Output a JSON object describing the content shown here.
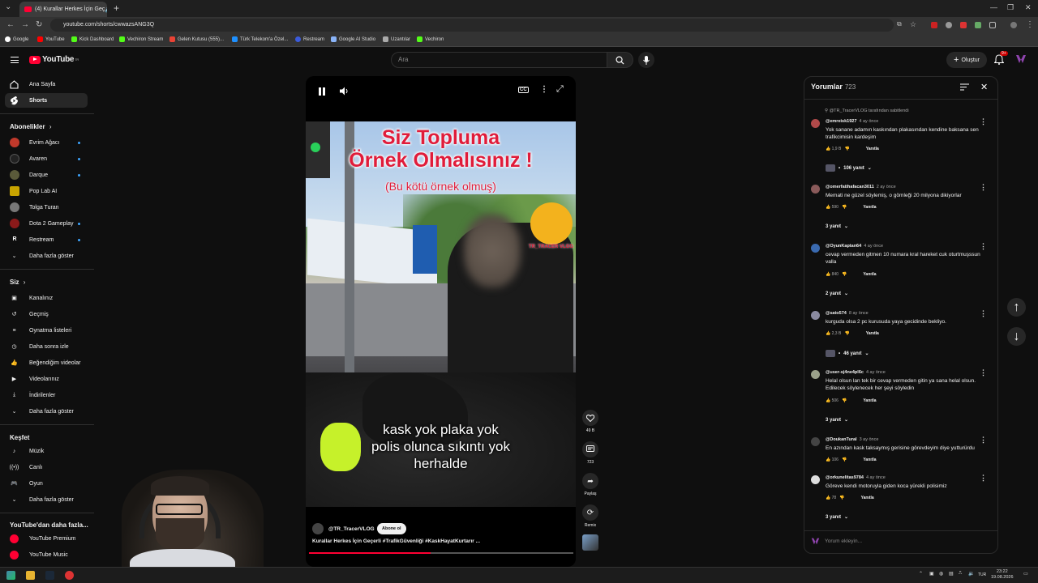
{
  "browser": {
    "tab_title": "(4) Kurallar Herkes İçin Geç",
    "url": "youtube.com/shorts/cwwazsANG3Q",
    "bookmarks": [
      "Google",
      "YouTube",
      "Kick Dashboard",
      "Vechiron Stream",
      "Gelen Kutusu (555)...",
      "Türk Telekom'a Özel...",
      "Restream",
      "Google AI Studio",
      "Uzantılar",
      "Vechiron"
    ]
  },
  "header": {
    "logo_text": "YouTube",
    "logo_sup": "TR",
    "search_placeholder": "Ara",
    "create_label": "Oluştur",
    "notification_count": "9+"
  },
  "sidebar": {
    "main": [
      {
        "label": "Ana Sayfa",
        "icon": "home-icon"
      },
      {
        "label": "Shorts",
        "icon": "shorts-icon",
        "active": true
      }
    ],
    "subscriptions_title": "Abonelikler",
    "subscriptions": [
      {
        "label": "Evrim Ağacı",
        "color": "#c0392b",
        "dot": true
      },
      {
        "label": "Avaren",
        "color": "#222222",
        "dot": true
      },
      {
        "label": "Darque",
        "color": "#5a5a3a",
        "dot": true
      },
      {
        "label": "Pop Lab AI",
        "color": "#c8a400",
        "dot": false
      },
      {
        "label": "Tolga Turan",
        "color": "#777777",
        "dot": false
      },
      {
        "label": "Dota 2 Gameplay",
        "color": "#8b1a1a",
        "dot": true
      },
      {
        "label": "Restream",
        "color": "#0f0f0f",
        "dot": true
      }
    ],
    "subscriptions_more": "Daha fazla göster",
    "you_title": "Siz",
    "you_items": [
      {
        "label": "Kanalınız",
        "icon": "channel-icon"
      },
      {
        "label": "Geçmiş",
        "icon": "history-icon"
      },
      {
        "label": "Oynatma listeleri",
        "icon": "playlist-icon"
      },
      {
        "label": "Daha sonra izle",
        "icon": "clock-icon"
      },
      {
        "label": "Beğendiğim videolar",
        "icon": "like-icon"
      },
      {
        "label": "Videolarınız",
        "icon": "video-icon"
      },
      {
        "label": "İndirilenler",
        "icon": "download-icon"
      },
      {
        "label": "Daha fazla göster",
        "icon": "chevron-down-icon"
      }
    ],
    "explore_title": "Keşfet",
    "explore_items": [
      {
        "label": "Müzik",
        "icon": "music-icon"
      },
      {
        "label": "Canlı",
        "icon": "live-icon"
      },
      {
        "label": "Oyun",
        "icon": "gaming-icon"
      },
      {
        "label": "Daha fazla göster",
        "icon": "chevron-down-icon"
      }
    ],
    "more_title": "YouTube'dan daha fazla...",
    "more_items": [
      {
        "label": "YouTube Premium"
      },
      {
        "label": "YouTube Music"
      }
    ]
  },
  "video": {
    "title_line1": "Siz Topluma",
    "title_line2": "Örnek Olmalısınız !",
    "subtitle": "(Bu kötü örnek olmuş)",
    "logo_text": "TR_TRACER VLOG",
    "caption_lines": [
      "kask yok plaka yok",
      "polis olunca sıkıntı yok",
      "herhalde"
    ],
    "channel": "@TR_TracerVLOG",
    "subscribe_label": "Abone ol",
    "description": "Kurallar Herkes İçin Geçerli #TrafikGüvenliği #KaskHayatKurtarır ...",
    "progress": 0.46
  },
  "actions": {
    "likes": "49 B",
    "comments": "723",
    "share": "Paylaş",
    "remix": "Remix"
  },
  "comments": {
    "title": "Yorumlar",
    "count": "723",
    "pinned_by": "@TR_TracerVLOG tarafından sabitlendi",
    "reply_label": "Yanıtla",
    "add_placeholder": "Yorum ekleyin...",
    "items": [
      {
        "user": "@emreisk1927",
        "time": "4 ay önce",
        "text": "Yok sanane adamın kaskından plakasından kendine baksana sen trafikcimisin kardeşim",
        "likes": "1,9 B",
        "replies": "106 yanıt",
        "color": "#b04a4a"
      },
      {
        "user": "@omerfatihafacan3011",
        "time": "2 ay önce",
        "text": "Memati ne güzel söylemiş, o gömleği 20 milyona dikiyorlar",
        "likes": "590",
        "replies": "3 yanıt",
        "color": "#8a5a5a"
      },
      {
        "user": "@OyunKaptan64",
        "time": "4 ay önce",
        "text": "cevap vermeden gitmen 10 numara kral hareket cuk oturtmuşssun valla",
        "likes": "840",
        "replies": "2 yanıt",
        "color": "#3a6ab0"
      },
      {
        "user": "@sato574",
        "time": "8 ay önce",
        "text": "kurguda olsa 2 pc kurusuda yaya gecidinde bekliyo.",
        "likes": "2,3 B",
        "replies": "46 yanıt",
        "color": "#8a8aa0"
      },
      {
        "user": "@user-sj4ne4pl6c",
        "time": "4 ay önce",
        "text": "Helal olsun lan tek bir cevap vermeden gitin ya sana helal olsun. Edilecek söylenecek her şeyi söyledin",
        "likes": "506",
        "replies": "3 yanıt",
        "color": "#9aa08a"
      },
      {
        "user": "@DoukanTural",
        "time": "3 ay önce",
        "text": "En azından kask taksaymış gerisine görevdeyim diye yutturürdu",
        "likes": "106",
        "replies": "",
        "color": "#444444"
      },
      {
        "user": "@orkunelitas9784",
        "time": "4 ay önce",
        "text": "Göreve kendi motoruyla giden koca yürekli polisimiz",
        "likes": "78",
        "replies": "3 yanıt",
        "color": "#dddddd"
      }
    ]
  },
  "taskbar": {
    "lang": "TUR",
    "time": "23:22",
    "date": "19.08.2026"
  }
}
